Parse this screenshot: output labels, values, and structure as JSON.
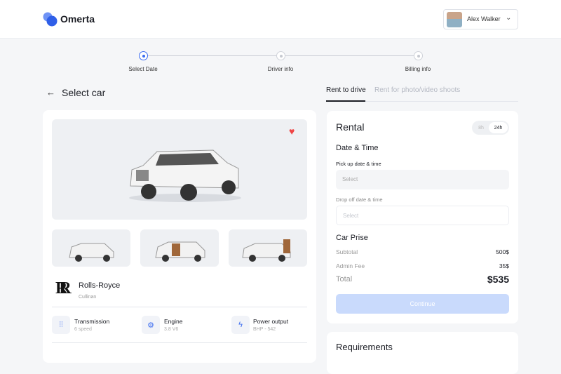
{
  "header": {
    "brand": "Omerta",
    "user_name": "Alex Walker"
  },
  "stepper": {
    "steps": [
      "Select Date",
      "Driver info",
      "Billing info"
    ],
    "active_index": 0
  },
  "page": {
    "title": "Select car"
  },
  "car": {
    "favorite": true,
    "brand": "Rolls-Royce",
    "logo_text": "RR",
    "model": "Cullinan",
    "specs": [
      {
        "icon": "gear-shift-icon",
        "title": "Transmission",
        "value": "6 speed"
      },
      {
        "icon": "engine-icon",
        "title": "Engine",
        "value": "3.8 V6"
      },
      {
        "icon": "lightning-icon",
        "title": "Power output",
        "value": "BHP - 542"
      }
    ]
  },
  "tabs": [
    "Rent to drive",
    "Rent for photo/video shoots"
  ],
  "rental": {
    "title": "Rental",
    "toggle": [
      "8h",
      "24h"
    ],
    "toggle_selected": "24h",
    "section": "Date & Time",
    "pickup_label": "Pick up date & time",
    "pickup_placeholder": "Select",
    "dropoff_label": "Drop off date & time",
    "dropoff_placeholder": "Select",
    "price_title": "Car Prise",
    "subtotal_label": "Subtotal",
    "subtotal": "500$",
    "fee_label": "Admin Fee",
    "fee": "35$",
    "total_label": "Total",
    "total": "$535",
    "continue": "Continue"
  },
  "requirements": {
    "title": "Requirements"
  },
  "colors": {
    "accent": "#3b6cf0",
    "heart": "#ef4444",
    "button_disabled": "#c9dafc"
  }
}
